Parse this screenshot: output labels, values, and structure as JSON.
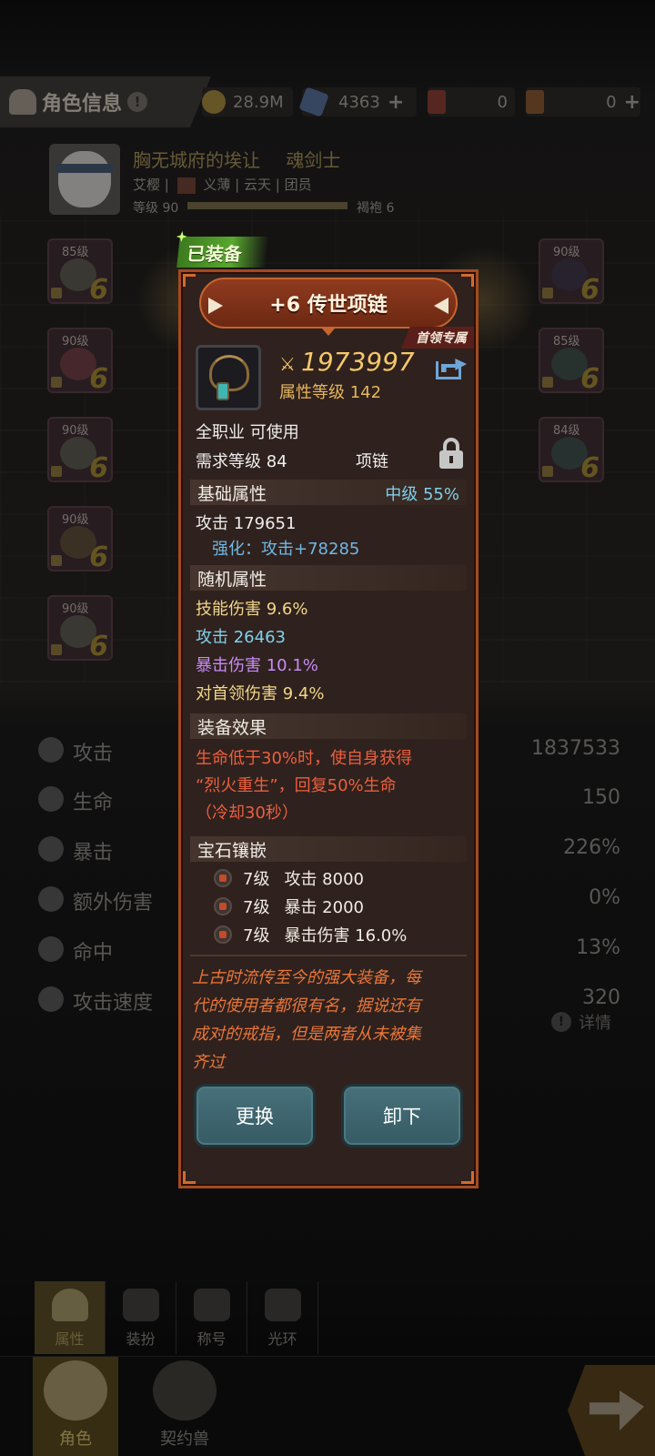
{
  "topbar": {
    "title": "角色信息",
    "gold": "28.9M",
    "crystal": "4363",
    "ticket_red": "0",
    "ticket_gold": "0"
  },
  "character": {
    "name": "胸无城府的埃让",
    "class": "魂剑士",
    "sub_left": "艾樱",
    "guild": "义薄",
    "server": "云天",
    "role": "团员",
    "level": "等级 90",
    "level2": "褐袍 6"
  },
  "slots": {
    "left": [
      "85级",
      "90级",
      "90级",
      "90级",
      "90级"
    ],
    "right": [
      "90级",
      "85级",
      "84级"
    ],
    "enhance": "6"
  },
  "stats": [
    {
      "label": "攻击",
      "value": "1837533"
    },
    {
      "label": "生命",
      "value": "150"
    },
    {
      "label": "暴击",
      "value": "226%"
    },
    {
      "label": "额外伤害",
      "value": "0%"
    },
    {
      "label": "命中",
      "value": "13%"
    },
    {
      "label": "攻击速度",
      "value": "320"
    }
  ],
  "detail_label": "详情",
  "subtabs": [
    "属性",
    "装扮",
    "称号",
    "光环"
  ],
  "bottom_tabs": [
    "角色",
    "契约兽"
  ],
  "popup": {
    "equipped_badge": "已装备",
    "title": "+6 传世项链",
    "boss_tag": "首领专属",
    "power": "1973997",
    "attr_level": "属性等级 142",
    "usable": "全职业 可使用",
    "req_level": "需求等级 84",
    "slot_type": "项链",
    "base_section": "基础属性",
    "grade": "中级",
    "grade_pct": "55%",
    "base_attack": "攻击 179651",
    "enhance": "强化：攻击+78285",
    "random_section": "随机属性",
    "random": [
      {
        "text": "技能伤害   9.6%",
        "color": "#f1d68a"
      },
      {
        "text": "攻击    26463",
        "color": "#7fd0ec"
      },
      {
        "text": "暴击伤害   10.1%",
        "color": "#c58cf5"
      },
      {
        "text": "对首领伤害   9.4%",
        "color": "#f1d68a"
      }
    ],
    "effect_section": "装备效果",
    "effect_lines": [
      "生命低于30%时，使自身获得",
      "“烈火重生”，回复50%生命",
      "（冷却30秒）"
    ],
    "gem_section": "宝石镶嵌",
    "gems": [
      {
        "level": "7级",
        "stat": "攻击 8000"
      },
      {
        "level": "7级",
        "stat": "暴击 2000"
      },
      {
        "level": "7级",
        "stat": "暴击伤害 16.0%"
      }
    ],
    "lore_lines": [
      "上古时流传至今的强大装备，每",
      "代的使用者都很有名，据说还有",
      "成对的戒指，但是两者从未被集",
      "齐过"
    ],
    "btn_replace": "更换",
    "btn_unequip": "卸下"
  }
}
